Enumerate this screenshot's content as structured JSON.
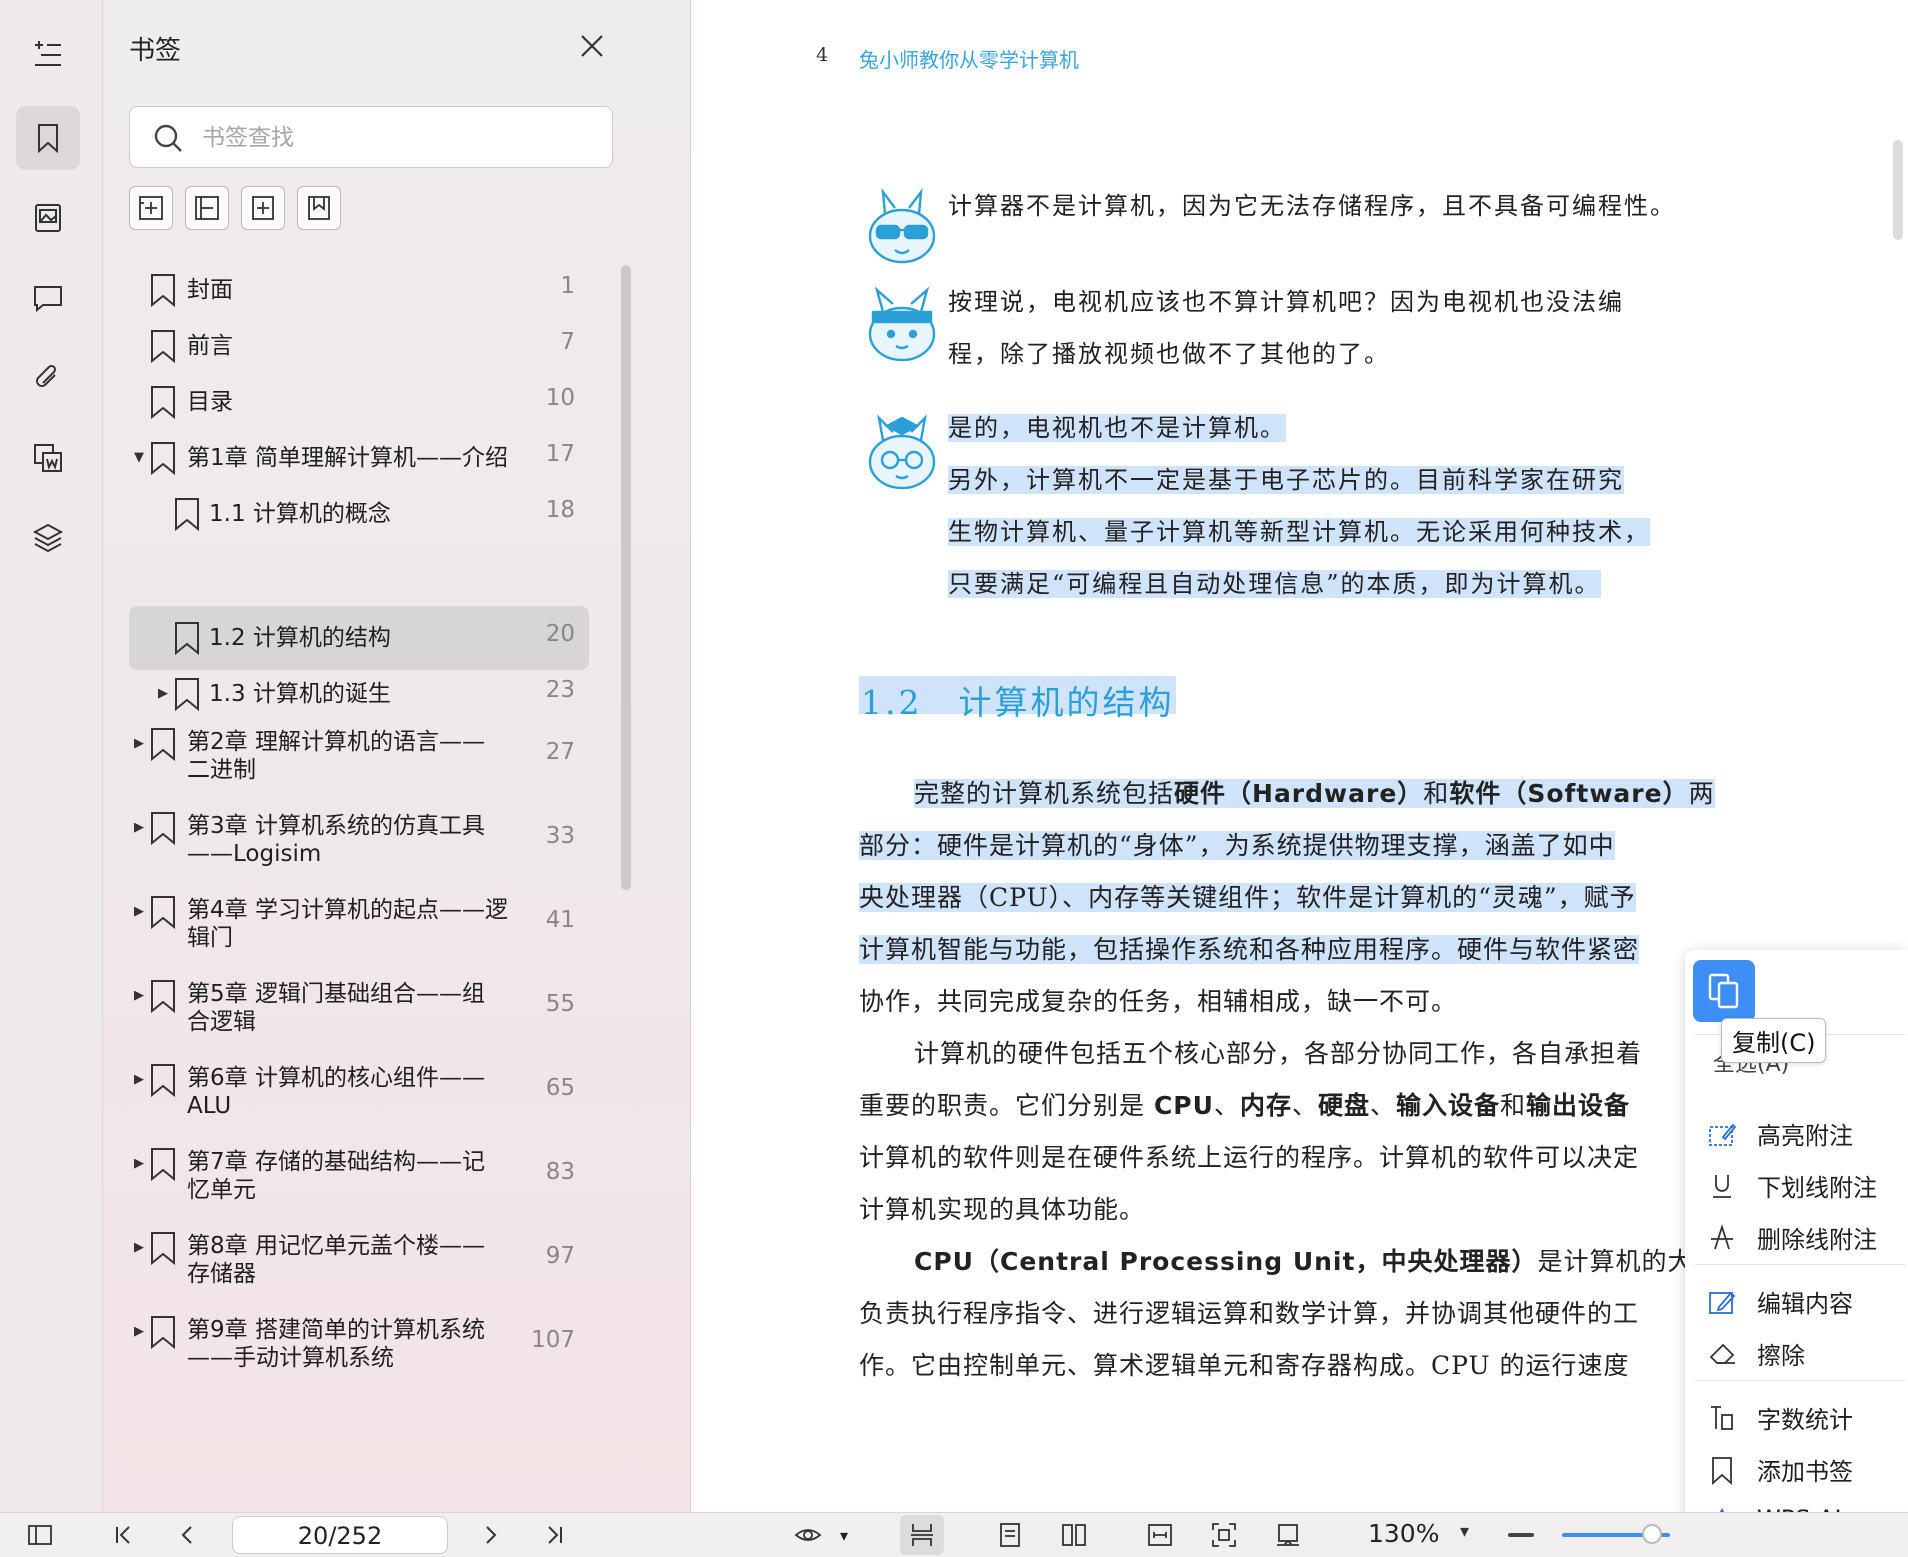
{
  "panel": {
    "title": "书签",
    "search_placeholder": "书签查找",
    "bookmarks": [
      {
        "label": "封面",
        "page": "1"
      },
      {
        "label": "前言",
        "page": "7"
      },
      {
        "label": "目录",
        "page": "10"
      },
      {
        "label": "第1章 简单理解计算机——介绍",
        "page": "17"
      },
      {
        "label": "1.1 计算机的概念",
        "page": "18"
      },
      {
        "label": "1.2 计算机的结构",
        "page": "20"
      },
      {
        "label": "1.3 计算机的诞生",
        "page": "23"
      },
      {
        "label_line1": "第2章 理解计算机的语言——",
        "label_line2": "二进制",
        "page": "27"
      },
      {
        "label_line1": "第3章 计算机系统的仿真工具",
        "label_line2": "——Logisim",
        "page": "33"
      },
      {
        "label_line1": "第4章 学习计算机的起点——逻",
        "label_line2": "辑门",
        "page": "41"
      },
      {
        "label_line1": "第5章 逻辑门基础组合——组",
        "label_line2": "合逻辑",
        "page": "55"
      },
      {
        "label_line1": "第6章 计算机的核心组件——",
        "label_line2": "ALU",
        "page": "65"
      },
      {
        "label_line1": "第7章 存储的基础结构——记",
        "label_line2": "忆单元",
        "page": "83"
      },
      {
        "label_line1": "第8章 用记忆单元盖个楼——",
        "label_line2": "存储器",
        "page": "97"
      },
      {
        "label_line1": "第9章 搭建简单的计算机系统",
        "label_line2": "——手动计算机系统",
        "page": "107"
      }
    ]
  },
  "document": {
    "page_number": "4",
    "running_head": "兔小师教你从零学计算机",
    "dialogue": {
      "d1": "计算器不是计算机，因为它无法存储程序，且不具备可编程性。",
      "d2_line1": "按理说，电视机应该也不算计算机吧？因为电视机也没法编",
      "d2_line2": "程，除了播放视频也做不了其他的了。",
      "d3_line1": "是的，电视机也不是计算机。",
      "d3_line2": "另外，计算机不一定是基于电子芯片的。目前科学家在研究",
      "d3_line3": "生物计算机、量子计算机等新型计算机。无论采用何种技术，",
      "d3_line4": "只要满足“可编程且自动处理信息”的本质，即为计算机。"
    },
    "section_heading": "1.2　计算机的结构",
    "p1": {
      "l1_a": "完整的计算机系统包括",
      "l1_b": "硬件（Hardware）",
      "l1_c": "和",
      "l1_d": "软件（Software）",
      "l1_e": "两",
      "l2": "部分：硬件是计算机的“身体”，为系统提供物理支撑，涵盖了如中",
      "l3": "央处理器（CPU）、内存等关键组件；软件是计算机的“灵魂”，赋予",
      "l4": "计算机智能与功能，包括操作系统和各种应用程序。硬件与软件紧密",
      "l5": "协作，共同完成复杂的任务，相辅相成，缺一不可。"
    },
    "p2": {
      "l1": "计算机的硬件包括五个核心部分，各部分协同工作，各自承担着",
      "l2_a": "重要的职责。它们分别是 ",
      "l2_b": "CPU",
      "l2_c": "、",
      "l2_d": "内存",
      "l2_e": "、",
      "l2_f": "硬盘",
      "l2_g": "、",
      "l2_h": "输入设备",
      "l2_i": "和",
      "l2_j": "输出设备",
      "l3": "计算机的软件则是在硬件系统上运行的程序。计算机的软件可以决定",
      "l4": "计算机实现的具体功能。"
    },
    "p3": {
      "l1_a": "CPU（Central Processing Unit，中央处理器）",
      "l1_b": "是计算机的大脑",
      "l2": "负责执行程序指令、进行逻辑运算和数学计算，并协调其他硬件的工",
      "l3": "作。它由控制单元、算术逻辑单元和寄存器构成。CPU 的运行速度"
    }
  },
  "context_menu": {
    "tooltip": "复制(C)",
    "hidden_item": "全选(A)",
    "items": [
      "高亮附注",
      "下划线附注",
      "删除线附注",
      "编辑内容",
      "擦除",
      "字数统计",
      "添加书签",
      "WPS AI"
    ]
  },
  "statusbar": {
    "page_indicator": "20/252",
    "zoom": "130%",
    "zoom_level_fraction": 0.83
  },
  "colors": {
    "accent": "#3d8ff5",
    "heading": "#2a9fd8",
    "highlight": "#cfe3fb"
  }
}
